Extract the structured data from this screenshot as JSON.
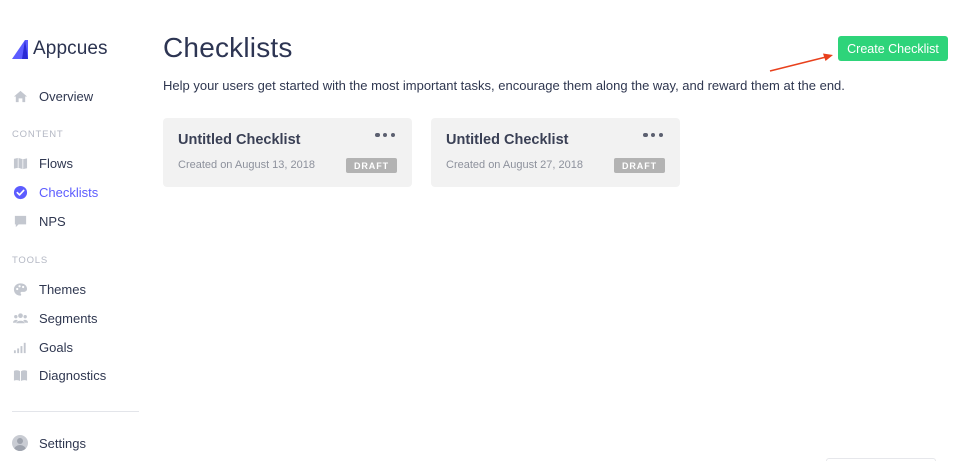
{
  "brand": {
    "name": "Appcues",
    "color": "#5c5cff"
  },
  "sidebar": {
    "overview": {
      "label": "Overview",
      "icon": "home-icon"
    },
    "content_section": "CONTENT",
    "content_items": [
      {
        "label": "Flows",
        "icon": "map-icon"
      },
      {
        "label": "Checklists",
        "icon": "check-circle-icon",
        "active": true
      },
      {
        "label": "NPS",
        "icon": "chat-icon"
      }
    ],
    "tools_section": "TOOLS",
    "tools_items": [
      {
        "label": "Themes",
        "icon": "palette-icon"
      },
      {
        "label": "Segments",
        "icon": "users-icon"
      },
      {
        "label": "Goals",
        "icon": "signal-bars-icon"
      },
      {
        "label": "Diagnostics",
        "icon": "book-icon"
      }
    ],
    "settings": {
      "label": "Settings",
      "icon": "avatar"
    }
  },
  "main": {
    "title": "Checklists",
    "description": "Help your users get started with the most important tasks, encourage them along the way, and reward them at the end.",
    "create_button": "Create Checklist",
    "create_button_color": "#2ed47a",
    "annotation_arrow_color": "#e8401c"
  },
  "checklists": [
    {
      "title": "Untitled Checklist",
      "created": "Created on August 13, 2018",
      "status": "DRAFT"
    },
    {
      "title": "Untitled Checklist",
      "created": "Created on August 27, 2018",
      "status": "DRAFT"
    }
  ]
}
